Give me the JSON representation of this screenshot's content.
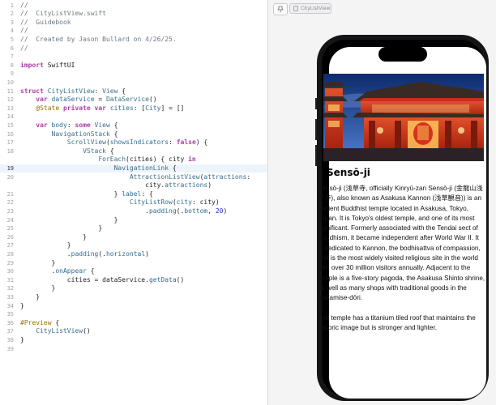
{
  "editor": {
    "lines": [
      {
        "n": "1",
        "segs": [
          [
            "tok-com",
            "//"
          ]
        ]
      },
      {
        "n": "2",
        "segs": [
          [
            "tok-com",
            "//  CityListView.swift"
          ]
        ]
      },
      {
        "n": "3",
        "segs": [
          [
            "tok-com",
            "//  Guidebook"
          ]
        ]
      },
      {
        "n": "4",
        "segs": [
          [
            "tok-com",
            "//"
          ]
        ]
      },
      {
        "n": "5",
        "segs": [
          [
            "tok-com",
            "//  Created by Jason Bullard on 4/26/25."
          ]
        ]
      },
      {
        "n": "6",
        "segs": [
          [
            "tok-com",
            "//"
          ]
        ]
      },
      {
        "n": "7",
        "segs": []
      },
      {
        "n": "8",
        "segs": [
          [
            "tok-kw",
            "import"
          ],
          [
            "tok-plain",
            " SwiftUI"
          ]
        ]
      },
      {
        "n": "9",
        "segs": []
      },
      {
        "n": "10",
        "segs": []
      },
      {
        "n": "11",
        "segs": [
          [
            "tok-kw",
            "struct"
          ],
          [
            "tok-plain",
            " "
          ],
          [
            "tok-type",
            "CityListView"
          ],
          [
            "tok-plain",
            ": "
          ],
          [
            "tok-type",
            "View"
          ],
          [
            "tok-plain",
            " {"
          ]
        ]
      },
      {
        "n": "12",
        "segs": [
          [
            "tok-plain",
            "    "
          ],
          [
            "tok-kw",
            "var"
          ],
          [
            "tok-plain",
            " "
          ],
          [
            "tok-fn",
            "dataService"
          ],
          [
            "tok-plain",
            " = "
          ],
          [
            "tok-type",
            "DataService"
          ],
          [
            "tok-plain",
            "()"
          ]
        ]
      },
      {
        "n": "13",
        "segs": [
          [
            "tok-plain",
            "    "
          ],
          [
            "tok-attr",
            "@State"
          ],
          [
            "tok-plain",
            " "
          ],
          [
            "tok-kw",
            "private"
          ],
          [
            "tok-plain",
            " "
          ],
          [
            "tok-kw",
            "var"
          ],
          [
            "tok-plain",
            " "
          ],
          [
            "tok-fn",
            "cities"
          ],
          [
            "tok-plain",
            ": ["
          ],
          [
            "tok-type",
            "City"
          ],
          [
            "tok-plain",
            "] = []"
          ]
        ]
      },
      {
        "n": "14",
        "segs": []
      },
      {
        "n": "15",
        "segs": [
          [
            "tok-plain",
            "    "
          ],
          [
            "tok-kw",
            "var"
          ],
          [
            "tok-plain",
            " "
          ],
          [
            "tok-fn",
            "body"
          ],
          [
            "tok-plain",
            ": "
          ],
          [
            "tok-kw",
            "some"
          ],
          [
            "tok-plain",
            " "
          ],
          [
            "tok-type",
            "View"
          ],
          [
            "tok-plain",
            " {"
          ]
        ]
      },
      {
        "n": "16",
        "segs": [
          [
            "tok-plain",
            "        "
          ],
          [
            "tok-type",
            "NavigationStack"
          ],
          [
            "tok-plain",
            " {"
          ]
        ]
      },
      {
        "n": "17",
        "segs": [
          [
            "tok-plain",
            "            "
          ],
          [
            "tok-type",
            "ScrollView"
          ],
          [
            "tok-plain",
            "("
          ],
          [
            "tok-fn",
            "showsIndicators"
          ],
          [
            "tok-plain",
            ": "
          ],
          [
            "tok-kw",
            "false"
          ],
          [
            "tok-plain",
            ") {"
          ]
        ]
      },
      {
        "n": "18",
        "segs": [
          [
            "tok-plain",
            "                "
          ],
          [
            "tok-type",
            "VStack"
          ],
          [
            "tok-plain",
            " {"
          ]
        ]
      },
      {
        "n": "",
        "segs": [
          [
            "tok-plain",
            "                    "
          ],
          [
            "tok-type",
            "ForEach"
          ],
          [
            "tok-plain",
            "(cities) { city "
          ],
          [
            "tok-kw",
            "in"
          ]
        ]
      },
      {
        "n": "19",
        "segs": [
          [
            "tok-plain",
            "                        "
          ],
          [
            "tok-type",
            "NavigationLink"
          ],
          [
            "tok-plain",
            " {"
          ]
        ]
      },
      {
        "n": "20",
        "segs": [
          [
            "tok-plain",
            "                            "
          ],
          [
            "tok-type",
            "AttractionListView"
          ],
          [
            "tok-plain",
            "("
          ],
          [
            "tok-fn",
            "attractions"
          ],
          [
            "tok-plain",
            ":"
          ]
        ]
      },
      {
        "n": "",
        "segs": [
          [
            "tok-plain",
            "                                city."
          ],
          [
            "tok-fn",
            "attractions"
          ],
          [
            "tok-plain",
            ")"
          ]
        ]
      },
      {
        "n": "21",
        "segs": [
          [
            "tok-plain",
            "                        } "
          ],
          [
            "tok-fn",
            "label"
          ],
          [
            "tok-plain",
            ": {"
          ]
        ]
      },
      {
        "n": "22",
        "segs": [
          [
            "tok-plain",
            "                            "
          ],
          [
            "tok-type",
            "CityListRow"
          ],
          [
            "tok-plain",
            "("
          ],
          [
            "tok-fn",
            "city"
          ],
          [
            "tok-plain",
            ": city)"
          ]
        ]
      },
      {
        "n": "23",
        "segs": [
          [
            "tok-plain",
            "                                ."
          ],
          [
            "tok-fn",
            "padding"
          ],
          [
            "tok-plain",
            "(."
          ],
          [
            "tok-fn",
            "bottom"
          ],
          [
            "tok-plain",
            ", "
          ],
          [
            "tok-num",
            "20"
          ],
          [
            "tok-plain",
            ")"
          ]
        ]
      },
      {
        "n": "24",
        "segs": [
          [
            "tok-plain",
            "                        }"
          ]
        ]
      },
      {
        "n": "25",
        "segs": [
          [
            "tok-plain",
            "                    }"
          ]
        ]
      },
      {
        "n": "26",
        "segs": [
          [
            "tok-plain",
            "                }"
          ]
        ]
      },
      {
        "n": "27",
        "segs": [
          [
            "tok-plain",
            "            }"
          ]
        ]
      },
      {
        "n": "28",
        "segs": [
          [
            "tok-plain",
            "            ."
          ],
          [
            "tok-fn",
            "padding"
          ],
          [
            "tok-plain",
            "(."
          ],
          [
            "tok-fn",
            "horizontal"
          ],
          [
            "tok-plain",
            ")"
          ]
        ]
      },
      {
        "n": "29",
        "segs": [
          [
            "tok-plain",
            "        }"
          ]
        ]
      },
      {
        "n": "30",
        "segs": [
          [
            "tok-plain",
            "        ."
          ],
          [
            "tok-fn",
            "onAppear"
          ],
          [
            "tok-plain",
            " {"
          ]
        ]
      },
      {
        "n": "31",
        "segs": [
          [
            "tok-plain",
            "            cities = dataService."
          ],
          [
            "tok-fn",
            "getData"
          ],
          [
            "tok-plain",
            "()"
          ]
        ]
      },
      {
        "n": "32",
        "segs": [
          [
            "tok-plain",
            "        }"
          ]
        ]
      },
      {
        "n": "33",
        "segs": [
          [
            "tok-plain",
            "    }"
          ]
        ]
      },
      {
        "n": "34",
        "segs": [
          [
            "tok-plain",
            "}"
          ]
        ]
      },
      {
        "n": "35",
        "segs": []
      },
      {
        "n": "36",
        "segs": [
          [
            "tok-attr",
            "#Preview"
          ],
          [
            "tok-plain",
            " {"
          ]
        ]
      },
      {
        "n": "37",
        "segs": [
          [
            "tok-plain",
            "    "
          ],
          [
            "tok-type",
            "CityListView"
          ],
          [
            "tok-plain",
            "()"
          ]
        ]
      },
      {
        "n": "38",
        "segs": [
          [
            "tok-plain",
            "}"
          ]
        ]
      },
      {
        "n": "39",
        "segs": []
      }
    ]
  },
  "canvas": {
    "preview_tab_label": "CityListView",
    "pin_icon": "pin-icon",
    "preview_icon": "device-icon"
  },
  "preview": {
    "title": "Sensō-ji",
    "paragraphs": [
      "Sensō-ji (浅草寺, officially Kinryū-zan Sensō-ji (金龍山浅草寺), also known as Asakusa Kannon (浅草観音)) is an ancient Buddhist temple located in Asakusa, Tokyo, Japan. It is Tokyo's oldest temple, and one of its most significant. Formerly associated with the Tendai sect of Buddhism, it became independent after World War II. It is dedicated to Kannon, the bodhisattva of compassion, and is the most widely visited religious site in the world with over 30 million visitors annually. Adjacent to the temple is a five-story pagoda, the Asakusa Shinto shrine, as well as many shops with traditional goods in the Nakamise-dōri.",
      "The temple has a titanium tiled roof that maintains the historic image but is stronger and lighter."
    ],
    "colors": {
      "sky_top": "#0d2b6e",
      "sky_bottom": "#3f6fc0",
      "temple_red": "#c8301c",
      "roof": "#3a2a24"
    }
  }
}
